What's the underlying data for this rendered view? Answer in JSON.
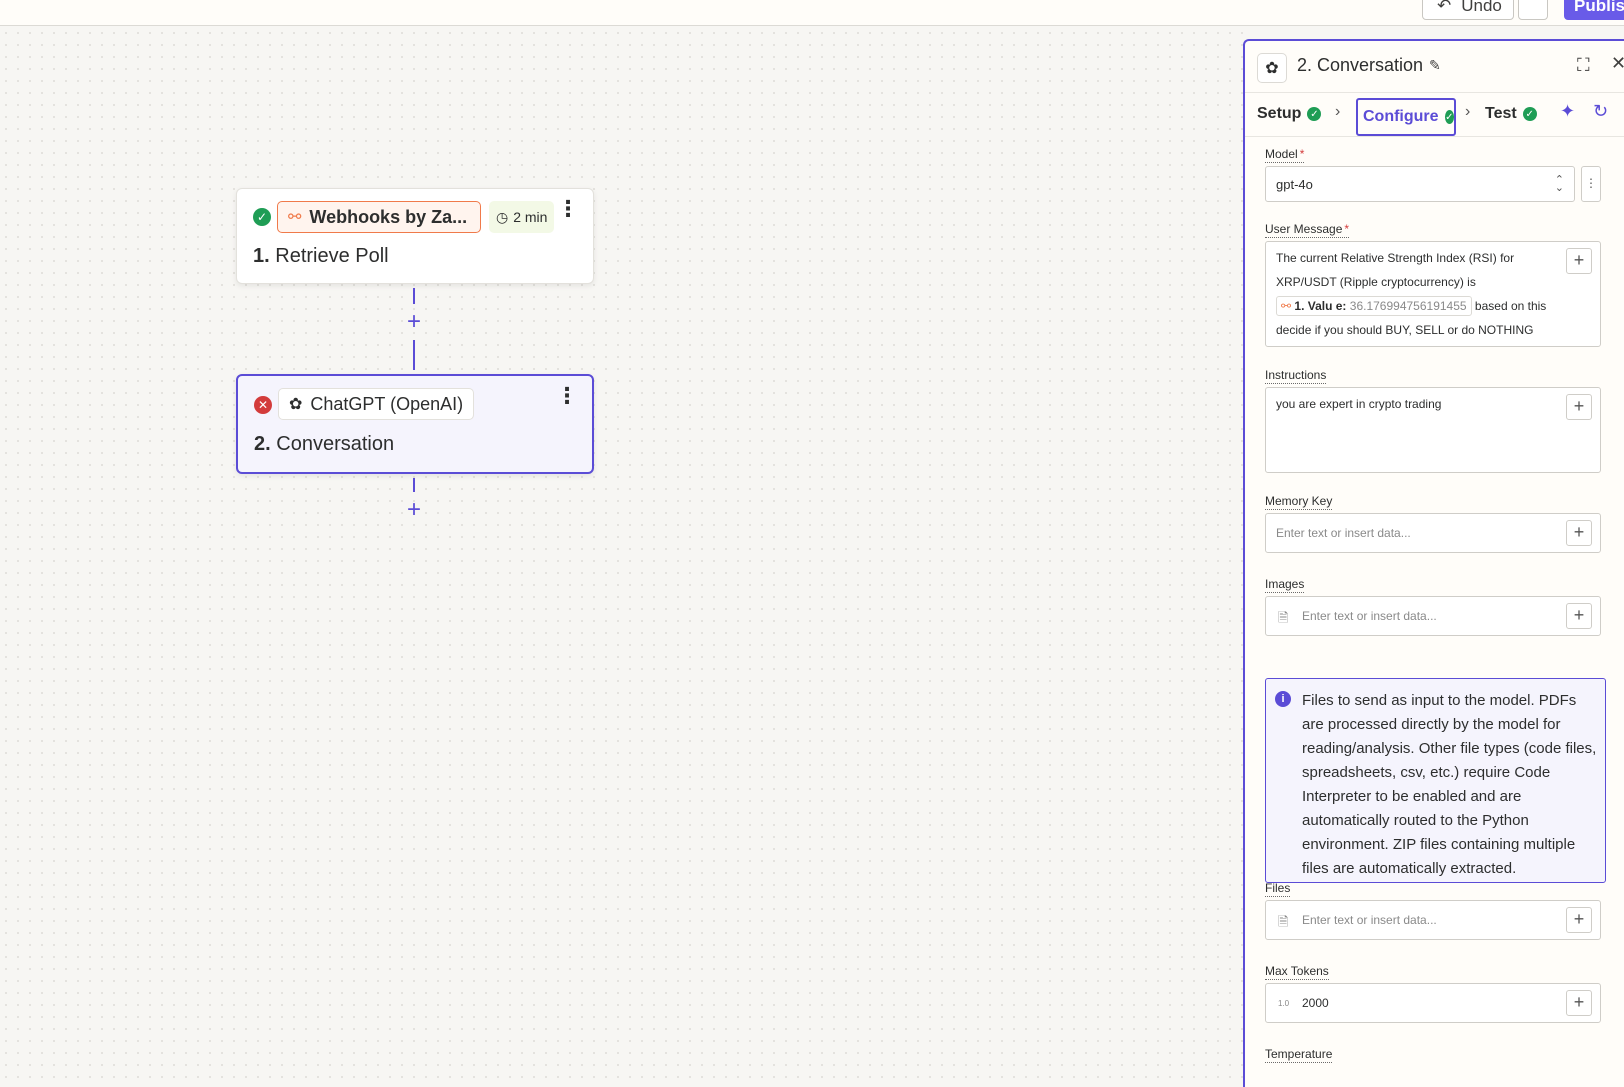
{
  "toolbar": {
    "undo_label": "Undo",
    "publish_label": "Publis"
  },
  "nodes": [
    {
      "app": "Webhooks by Za...",
      "duration": "2 min",
      "number": "1.",
      "title": "Retrieve Poll",
      "status": "success"
    },
    {
      "app": "ChatGPT (OpenAI)",
      "number": "2.",
      "title": "Conversation",
      "status": "error"
    }
  ],
  "panel": {
    "title": "2. Conversation",
    "steps": {
      "setup": "Setup",
      "configure": "Configure",
      "test": "Test"
    },
    "fields": {
      "model": {
        "label": "Model",
        "value": "gpt-4o"
      },
      "user_message": {
        "label": "User Message",
        "text_before": "The current Relative Strength Index (RSI) for XRP/USDT (Ripple cryptocurrency) is ",
        "token_label": "1. Valu e:",
        "token_value": "36.176994756191455",
        "text_after": " based on this decide if you should BUY, SELL or do NOTHING"
      },
      "instructions": {
        "label": "Instructions",
        "value": "you are expert in crypto trading"
      },
      "memory_key": {
        "label": "Memory Key",
        "placeholder": "Enter text or insert data..."
      },
      "images": {
        "label": "Images",
        "placeholder": "Enter text or insert data..."
      },
      "info": "Files to send as input to the model. PDFs are processed directly by the model for reading/analysis. Other file types (code files, spreadsheets, csv, etc.) require Code Interpreter to be enabled and are automatically routed to the Python environment. ZIP files containing multiple files are automatically extracted.",
      "files": {
        "label": "Files",
        "placeholder": "Enter text or insert data..."
      },
      "max_tokens": {
        "label": "Max Tokens",
        "type_badge": "1.0",
        "value": "2000"
      },
      "temperature": {
        "label": "Temperature"
      }
    }
  }
}
